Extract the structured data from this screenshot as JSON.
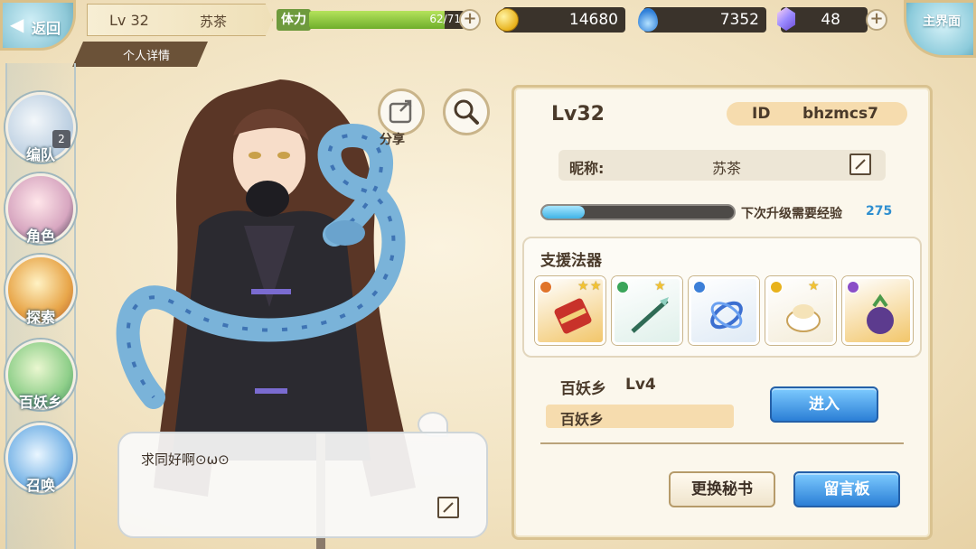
{
  "topbar": {
    "back_label": "返回",
    "level_label": "Lv 32",
    "player_name": "苏茶",
    "detail_tab": "个人详情",
    "stamina_label": "体力",
    "stamina_text": "62/71",
    "stamina_fraction": 0.87,
    "coins": "14680",
    "spirit": "7352",
    "gems": "48",
    "home_label": "主界面"
  },
  "nav": {
    "team": "编队",
    "team_badge": "2",
    "role": "角色",
    "explore": "探索",
    "village": "百妖乡",
    "summon": "召唤"
  },
  "character": {
    "share_label": "分享",
    "message": "求同好啊⊙ω⊙"
  },
  "profile": {
    "level": "Lv32",
    "id_key": "ID",
    "id_value": "bhzmcs7",
    "nickname_key": "昵称:",
    "nickname_value": "苏茶",
    "exp_label": "下次升级需要经验",
    "exp_value": "275",
    "exp_fraction": 0.22,
    "support_title": "支援法器",
    "items": [
      {
        "name": "red-scroll",
        "stars": 2,
        "element_color": "#e0742a",
        "bg": "#f2c66a"
      },
      {
        "name": "jade-spear",
        "stars": 1,
        "element_color": "#3aa55a",
        "bg": "#dff0ea"
      },
      {
        "name": "blue-rings",
        "stars": 0,
        "element_color": "#3c7fd8",
        "bg": "#dfeaf5"
      },
      {
        "name": "white-lotus-bowl",
        "stars": 1,
        "element_color": "#e8b21c",
        "bg": "#f4ecd8"
      },
      {
        "name": "purple-pot",
        "stars": 0,
        "element_color": "#8a4ec7",
        "bg": "#f2c66a"
      }
    ],
    "village_name": "百妖乡",
    "village_level": "Lv4",
    "village_bar": "百妖乡",
    "enter_button": "进入",
    "change_secretary": "更换秘书",
    "message_board": "留言板"
  },
  "colors": {
    "accent_blue": "#2b7fd6",
    "panel_bg": "#fbf7ec",
    "stamina_green": "#6fae2b"
  }
}
